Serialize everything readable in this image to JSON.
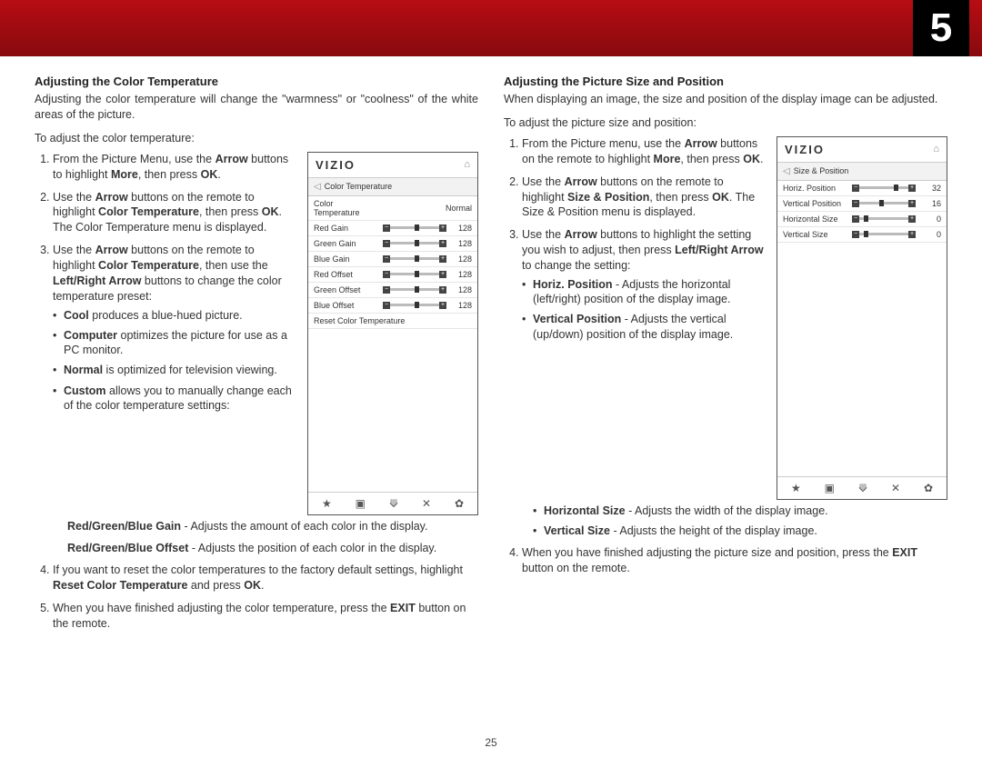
{
  "page_tab": "5",
  "page_number": "25",
  "left": {
    "title": "Adjusting the Color Temperature",
    "intro": "Adjusting the color temperature will change the \"warmness\" or \"coolness\" of the white areas of the picture.",
    "lead": "To adjust the color temperature:",
    "s1a": "From the Picture Menu, use the ",
    "s1b": "Arrow",
    "s1c": " buttons to highlight ",
    "s1d": "More",
    "s1e": ", then press ",
    "s1f": "OK",
    "s1g": ".",
    "s2a": "Use the ",
    "s2b": "Arrow",
    "s2c": " buttons on the remote to highlight ",
    "s2d": "Color Temperature",
    "s2e": ", then press ",
    "s2f": "OK",
    "s2g": ". The Color Temperature menu is displayed.",
    "s3a": "Use the ",
    "s3b": "Arrow",
    "s3c": " buttons on the remote to highlight ",
    "s3d": "Color Temperature",
    "s3e": ", then use the ",
    "s3f": "Left/Right Arrow",
    "s3g": " buttons to change the color temperature preset:",
    "bullet_cool_b": "Cool",
    "bullet_cool_t": " produces a blue-hued picture.",
    "bullet_comp_b": "Computer",
    "bullet_comp_t": " optimizes the picture for use as a PC monitor.",
    "bullet_norm_b": "Normal",
    "bullet_norm_t": " is optimized for television viewing.",
    "bullet_cust_b": "Custom",
    "bullet_cust_t": " allows you to manually change each of the color temperature settings:",
    "gain_b": "Red/Green/Blue Gain",
    "gain_t": " - Adjusts the amount of each color in the display.",
    "off_b": "Red/Green/Blue Offset",
    "off_t": " - Adjusts the position of each color in the display.",
    "s4a": "If you want to reset the color temperatures to the factory default settings, highlight ",
    "s4b": "Reset Color Temperature",
    "s4c": " and press ",
    "s4d": "OK",
    "s4e": ".",
    "s5a": "When you have finished adjusting the color temperature, press the ",
    "s5b": "EXIT",
    "s5c": " button on the remote."
  },
  "right": {
    "title": "Adjusting the Picture Size and Position",
    "intro": "When displaying an image, the size and position of the display image can be adjusted.",
    "lead": "To adjust the picture size and position:",
    "s1a": "From the Picture menu, use the ",
    "s1b": "Arrow",
    "s1c": " buttons on the remote to highlight ",
    "s1d": "More",
    "s1e": ", then press ",
    "s1f": "OK",
    "s1g": ".",
    "s2a": "Use the ",
    "s2b": "Arrow",
    "s2c": " buttons on the remote to highlight ",
    "s2d": "Size & Position",
    "s2e": ", then press ",
    "s2f": "OK",
    "s2g": ". The Size & Position menu is displayed.",
    "s3a": "Use the ",
    "s3b": "Arrow",
    "s3c": " buttons to highlight the setting you wish to adjust, then press ",
    "s3d": "Left/Right Arrow",
    "s3e": " to change the setting:",
    "bh_b": "Horiz. Position",
    "bh_t": " - Adjusts the horizontal (left/right) position of the display image.",
    "bv_b": "Vertical Position",
    "bv_t": " - Adjusts the vertical (up/down) position of the display image.",
    "bhs_b": "Horizontal Size",
    "bhs_t": " - Adjusts the width of the display image.",
    "bvs_b": "Vertical Size",
    "bvs_t": " - Adjusts the height of the display image.",
    "s4a": "When you have finished adjusting the picture size and position, press the ",
    "s4b": "EXIT",
    "s4c": " button on the remote."
  },
  "vizio": {
    "logo": "VIZIO",
    "ct_crumb": "Color Temperature",
    "ct_rows": [
      {
        "label": "Color Temperature",
        "text": "Normal"
      },
      {
        "label": "Red Gain",
        "val": "128",
        "knob": 50
      },
      {
        "label": "Green Gain",
        "val": "128",
        "knob": 50
      },
      {
        "label": "Blue Gain",
        "val": "128",
        "knob": 50
      },
      {
        "label": "Red Offset",
        "val": "128",
        "knob": 50
      },
      {
        "label": "Green Offset",
        "val": "128",
        "knob": 50
      },
      {
        "label": "Blue Offset",
        "val": "128",
        "knob": 50
      }
    ],
    "ct_reset": "Reset Color Temperature",
    "sp_crumb": "Size & Position",
    "sp_rows": [
      {
        "label": "Horiz. Position",
        "val": "32",
        "knob": 70
      },
      {
        "label": "Vertical Position",
        "val": "16",
        "knob": 40
      },
      {
        "label": "Horizontal Size",
        "val": "0",
        "knob": 10
      },
      {
        "label": "Vertical Size",
        "val": "0",
        "knob": 10
      }
    ]
  }
}
